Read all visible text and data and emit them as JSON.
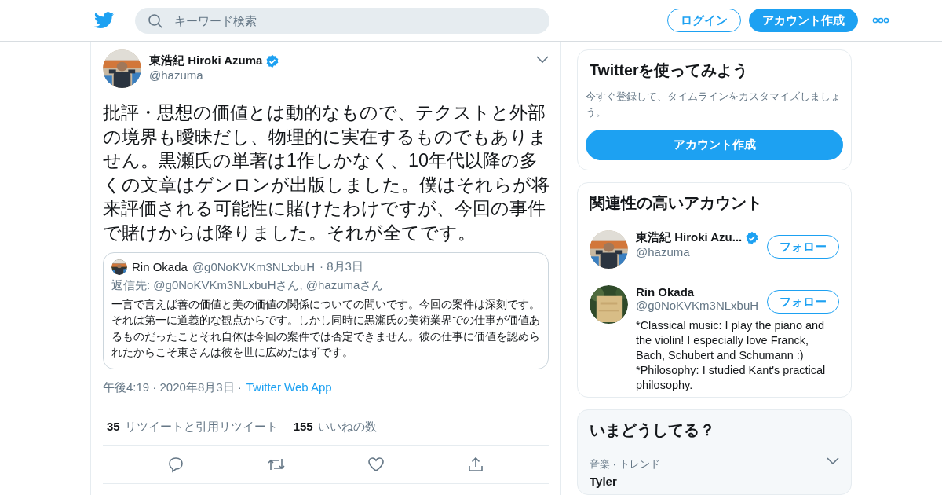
{
  "header": {
    "search_placeholder": "キーワード検索",
    "login": "ログイン",
    "signup": "アカウント作成"
  },
  "tweet": {
    "author": {
      "name": "東浩紀 Hiroki Azuma",
      "handle": "@hazuma",
      "verified": true
    },
    "text": "批評・思想の価値とは動的なもので、テクストと外部の境界も曖昧だし、物理的に実在するものでもありません。黒瀬氏の単著は1作しかなく、10年代以降の多くの文章はゲンロンが出版しました。僕はそれらが将来評価される可能性に賭けたわけですが、今回の事件で賭けからは降りました。それが全てです。",
    "quote": {
      "author": "Rin Okada",
      "handle": "@g0NoKVKm3NLxbuH",
      "date": "· 8月3日",
      "reply_to": "返信先: @g0NoKVKm3NLxbuHさん, @hazumaさん",
      "text": "一言で言えば善の価値と美の価値の関係についての問いです。今回の案件は深刻です。それは第一に道義的な観点からです。しかし同時に黒瀬氏の美術業界での仕事が価値あるものだったことそれ自体は今回の案件では否定できません。彼の仕事に価値を認められたからこそ東さんは彼を世に広めたはずです。"
    },
    "timestamp": "午後4:19 · 2020年8月3日 ·",
    "source": "Twitter Web App",
    "stats": [
      {
        "count": "35",
        "label": "リツイートと引用リツイート"
      },
      {
        "count": "155",
        "label": "いいねの数"
      }
    ]
  },
  "signup_card": {
    "title": "Twitterを使ってみよう",
    "text": "今すぐ登録して、タイムラインをカスタマイズしましょう。",
    "button": "アカウント作成"
  },
  "who_to_follow": {
    "title": "関連性の高いアカウント",
    "accounts": [
      {
        "name": "東浩紀 Hiroki Azu...",
        "handle": "@hazuma",
        "verified": true,
        "button": "フォロー"
      },
      {
        "name": "Rin Okada",
        "handle": "@g0NoKVKm3NLxbuH",
        "verified": false,
        "bio": "*Classical music: I play the piano and the violin! I especially love Franck, Bach, Schubert and Schumann :)\n*Philosophy: I studied Kant's practical philosophy.",
        "button": "フォロー"
      }
    ]
  },
  "trends": {
    "title": "いまどうしてる？",
    "items": [
      {
        "context": "音楽 · トレンド",
        "name": "Tyler"
      }
    ]
  }
}
